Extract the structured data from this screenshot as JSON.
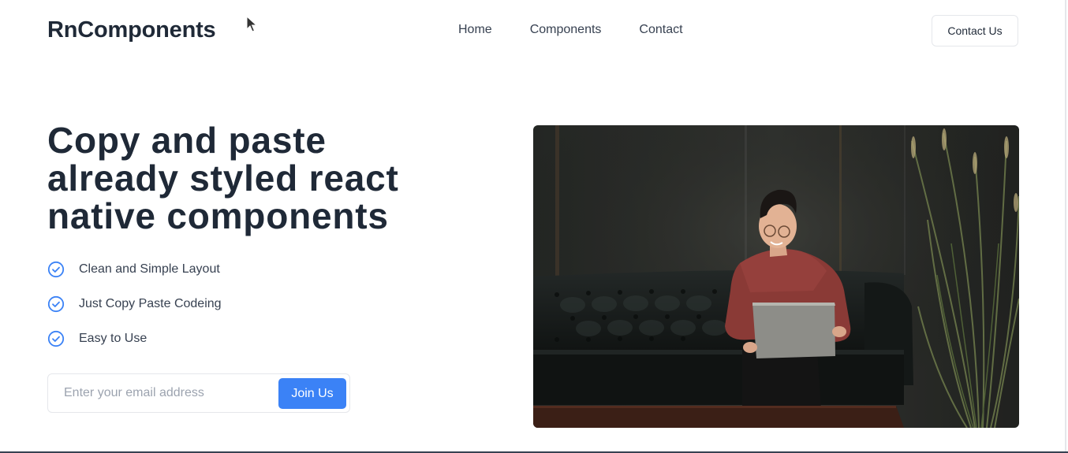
{
  "header": {
    "logo": "RnComponents",
    "nav": [
      {
        "label": "Home"
      },
      {
        "label": "Components"
      },
      {
        "label": "Contact"
      }
    ],
    "cta_label": "Contact Us"
  },
  "hero": {
    "title": "Copy and paste already styled react native components",
    "features": [
      {
        "label": "Clean and Simple Layout",
        "icon": "check-circle-icon"
      },
      {
        "label": "Just Copy Paste Codeing",
        "icon": "check-circle-icon"
      },
      {
        "label": "Easy to Use",
        "icon": "check-circle-icon"
      }
    ],
    "email_placeholder": "Enter your email address",
    "email_value": "",
    "join_label": "Join Us",
    "image_subject": "person with laptop on leather sofa"
  },
  "colors": {
    "primary": "#3b82f6",
    "text_dark": "#1f2937",
    "text_body": "#374151",
    "border": "#e5e7eb"
  }
}
